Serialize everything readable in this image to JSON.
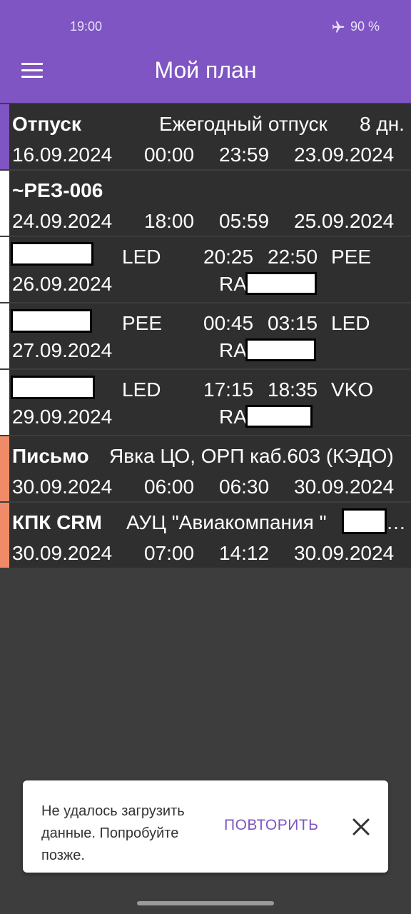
{
  "status_bar": {
    "time": "19:00",
    "battery": "90 %",
    "icons": [
      "airplane-mode-icon"
    ]
  },
  "app_bar": {
    "title": "Мой план",
    "menu_icon": "hamburger-menu-icon"
  },
  "colors": {
    "primary": "#7e55c2",
    "accent_orange": "#f08b69",
    "row_bg": "#2f2f2f",
    "page_bg": "#3d3d3d"
  },
  "plan_items": [
    {
      "accent": "purple",
      "title": "Отпуск",
      "description": "Ежегодный отпуск",
      "duration": "8 дн.",
      "start_date": "16.09.2024",
      "start_time": "00:00",
      "end_time": "23:59",
      "end_date": "23.09.2024"
    },
    {
      "accent": "white",
      "title": "~РЕЗ-006",
      "start_date": "24.09.2024",
      "start_time": "18:00",
      "end_time": "05:59",
      "end_date": "25.09.2024"
    },
    {
      "accent": "white",
      "from": "LED",
      "dep_time": "20:25",
      "arr_time": "22:50",
      "to": "PEE",
      "date": "26.09.2024",
      "aircraft": "RA"
    },
    {
      "accent": "white",
      "from": "PEE",
      "dep_time": "00:45",
      "arr_time": "03:15",
      "to": "LED",
      "date": "27.09.2024",
      "aircraft": "RA"
    },
    {
      "accent": "white",
      "from": "LED",
      "dep_time": "17:15",
      "arr_time": "18:35",
      "to": "VKO",
      "date": "29.09.2024",
      "aircraft": "RA"
    },
    {
      "accent": "orange",
      "title": "Письмо",
      "description": "Явка ЦО, ОРП каб.603 (КЭДО)",
      "start_date": "30.09.2024",
      "start_time": "06:00",
      "end_time": "06:30",
      "end_date": "30.09.2024"
    },
    {
      "accent": "orange",
      "title": "КПК CRM",
      "description_prefix": "АУЦ \"Авиакомпания \"",
      "description_suffix": "…",
      "start_date": "30.09.2024",
      "start_time": "07:00",
      "end_time": "14:12",
      "end_date": "30.09.2024"
    }
  ],
  "snackbar": {
    "message": "Не удалось загрузить данные. Попробуйте позже.",
    "action": "ПОВТОРИТЬ",
    "close_icon": "close-icon"
  }
}
